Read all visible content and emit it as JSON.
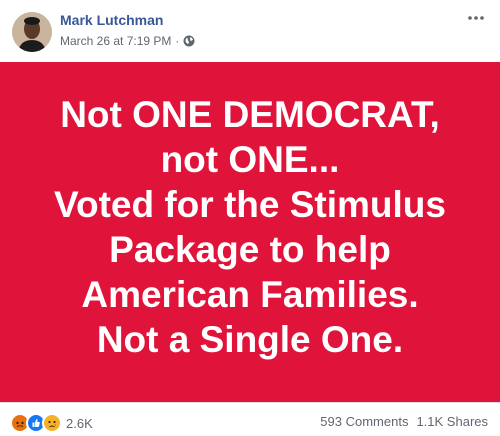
{
  "post": {
    "author": "Mark Lutchman",
    "timestamp": "March 26 at 7:19 PM",
    "separator": "·",
    "privacy_icon": "globe-icon",
    "more_icon": "more-horizontal-icon",
    "avatar_icon": "profile-photo"
  },
  "image": {
    "background_color": "#e0143b",
    "text_color": "#ffffff",
    "lines": [
      "Not ONE DEMOCRAT,",
      "not ONE...",
      "Voted for the Stimulus",
      "Package to help",
      "American Families.",
      "Not a Single One."
    ]
  },
  "footer": {
    "reaction_icons": [
      "angry-reaction-icon",
      "like-reaction-icon",
      "sad-reaction-icon"
    ],
    "reaction_count": "2.6K",
    "comments": "593 Comments",
    "shares": "1.1K Shares"
  }
}
